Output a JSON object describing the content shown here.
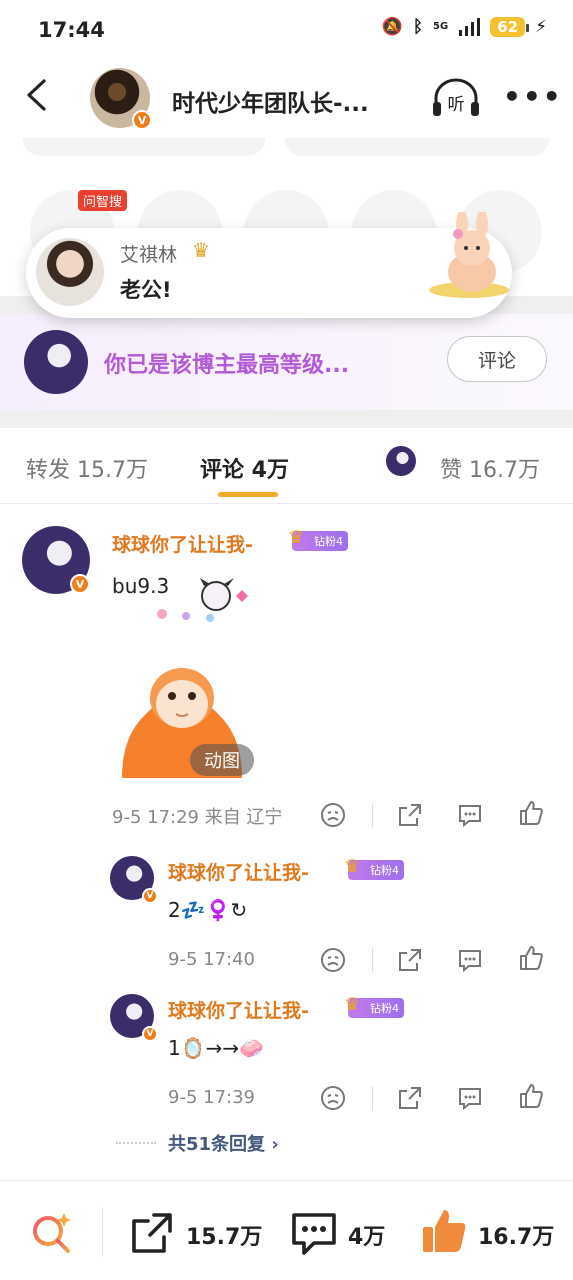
{
  "status_bar": {
    "time": "17:44",
    "network": "5G",
    "battery": "62"
  },
  "header": {
    "title": "时代少年团队长-...",
    "listen_label": "听"
  },
  "toast": {
    "name": "艾祺林",
    "message": "老公!"
  },
  "ask_badge": "问智搜",
  "level_banner": {
    "text": "你已是该博主最高等级...",
    "button": "评论"
  },
  "tabs": {
    "repost": "转发 15.7万",
    "comments": "评论 4万",
    "likes": "赞 16.7万"
  },
  "comment": {
    "user": "球球你了让让我-",
    "fan_badge": "钻粉4",
    "text": "bu9.3",
    "gif_label": "动图",
    "meta": "9-5 17:29 来自 辽宁"
  },
  "replies": [
    {
      "user": "球球你了让让我-",
      "fan_badge": "钻粉4",
      "text": "2💤♀️↻",
      "time": "9-5 17:40"
    },
    {
      "user": "球球你了让让我-",
      "fan_badge": "钻粉4",
      "text": "1🪞→→🧼",
      "time": "9-5 17:39"
    }
  ],
  "more_replies": "共51条回复 ›",
  "bottom_bar": {
    "repost_count": "15.7万",
    "comment_count": "4万",
    "like_count": "16.7万"
  },
  "colors": {
    "accent_orange": "#e0781e",
    "tab_underline": "#f2a828",
    "level_purple": "#b35ad9",
    "reply_link": "#44577c",
    "like_orange": "#f08a3c"
  }
}
